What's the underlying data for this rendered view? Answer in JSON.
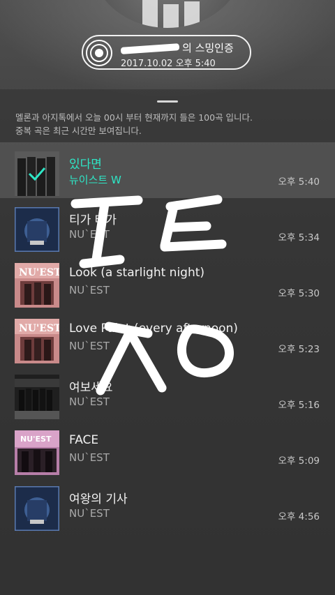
{
  "header": {
    "title_suffix": "의 스밍인증",
    "datetime": "2017.10.02 오후 5:40"
  },
  "info": {
    "line1": "멜론과 아지톡에서 오늘 00시 부터 현재까지 들은 100곡 입니다.",
    "line2": "중복 곡은 최근 시간만 보여집니다."
  },
  "colors": {
    "accent": "#2ee6c6",
    "text": "#f2f2f2",
    "muted": "#a9a9a9"
  },
  "songs": [
    {
      "title": "있다면",
      "artist": "뉴이스트 W",
      "time": "오후 5:40",
      "active": true
    },
    {
      "title": "티가 태가",
      "artist": "NU`EST",
      "time": "오후 5:34"
    },
    {
      "title": "Look (a starlight night)",
      "artist": "NU`EST",
      "time": "오후 5:30"
    },
    {
      "title": "Love Paint (every afternoon)",
      "artist": "NU`EST",
      "time": "오후 5:23"
    },
    {
      "title": "여보세요",
      "artist": "NU`EST",
      "time": "오후 5:16"
    },
    {
      "title": "FACE",
      "artist": "NU`EST",
      "time": "오후 5:09"
    },
    {
      "title": "여왕의 기사",
      "artist": "NU`EST",
      "time": "오후 4:56"
    }
  ]
}
